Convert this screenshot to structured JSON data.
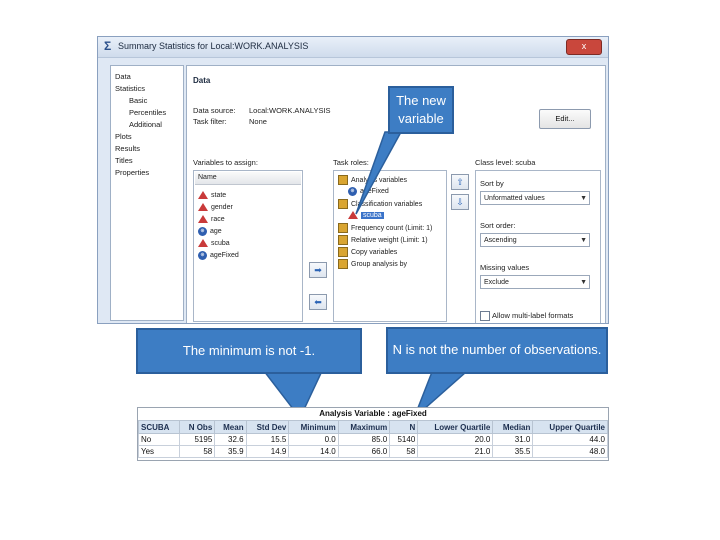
{
  "window": {
    "title": "Summary Statistics for Local:WORK.ANALYSIS",
    "close_label": "x"
  },
  "nav": {
    "items": [
      {
        "label": "Data"
      },
      {
        "label": "Statistics"
      },
      {
        "label": "Basic"
      },
      {
        "label": "Percentiles"
      },
      {
        "label": "Additional"
      },
      {
        "label": "Plots"
      },
      {
        "label": "Results"
      },
      {
        "label": "Titles"
      },
      {
        "label": "Properties"
      }
    ]
  },
  "main": {
    "heading": "Data",
    "data_source_label": "Data source:",
    "data_source_value": "Local:WORK.ANALYSIS",
    "task_filter_label": "Task filter:",
    "task_filter_value": "None",
    "edit_label": "Edit..."
  },
  "vars_to_assign": {
    "label": "Variables to assign:",
    "column_header": "Name",
    "items": [
      {
        "name": "state",
        "icon": "triangle-icon"
      },
      {
        "name": "gender",
        "icon": "triangle-icon"
      },
      {
        "name": "race",
        "icon": "triangle-icon"
      },
      {
        "name": "age",
        "icon": "circle-icon"
      },
      {
        "name": "scuba",
        "icon": "triangle-icon"
      },
      {
        "name": "ageFixed",
        "icon": "circle-icon"
      }
    ]
  },
  "task_roles": {
    "label": "Task roles:",
    "items": [
      {
        "label": "Analysis variables"
      },
      {
        "label": "ageFixed"
      },
      {
        "label": "Classification variables"
      },
      {
        "label": "scuba"
      },
      {
        "label": "Frequency count  (Limit: 1)"
      },
      {
        "label": "Relative weight  (Limit: 1)"
      },
      {
        "label": "Copy variables"
      },
      {
        "label": "Group analysis by"
      }
    ]
  },
  "class_scuba": {
    "label": "Class level: scuba",
    "sort_by_label": "Sort by",
    "sort_by_value": "Unformatted values",
    "sort_order_label": "Sort order:",
    "sort_order_value": "Ascending",
    "missing_label": "Missing values",
    "missing_value": "Exclude",
    "multilabel_label": "Allow multi-label formats"
  },
  "callouts": {
    "new_variable": "The new variable",
    "minimum": "The minimum is not -1.",
    "n_obs": "N is not the number of observations."
  },
  "results": {
    "caption": "Analysis Variable : ageFixed",
    "headers": [
      "SCUBA",
      "N Obs",
      "Mean",
      "Std Dev",
      "Minimum",
      "Maximum",
      "N",
      "Lower Quartile",
      "Median",
      "Upper Quartile"
    ],
    "rows": [
      [
        "No",
        "5195",
        "32.6",
        "15.5",
        "0.0",
        "85.0",
        "5140",
        "20.0",
        "31.0",
        "44.0"
      ],
      [
        "Yes",
        "58",
        "35.9",
        "14.9",
        "14.0",
        "66.0",
        "58",
        "21.0",
        "35.5",
        "48.0"
      ]
    ]
  },
  "colors": {
    "callout_fill": "#3d7dc4",
    "callout_border": "#2b5f9c",
    "header_fill": "#d7e3f0"
  }
}
